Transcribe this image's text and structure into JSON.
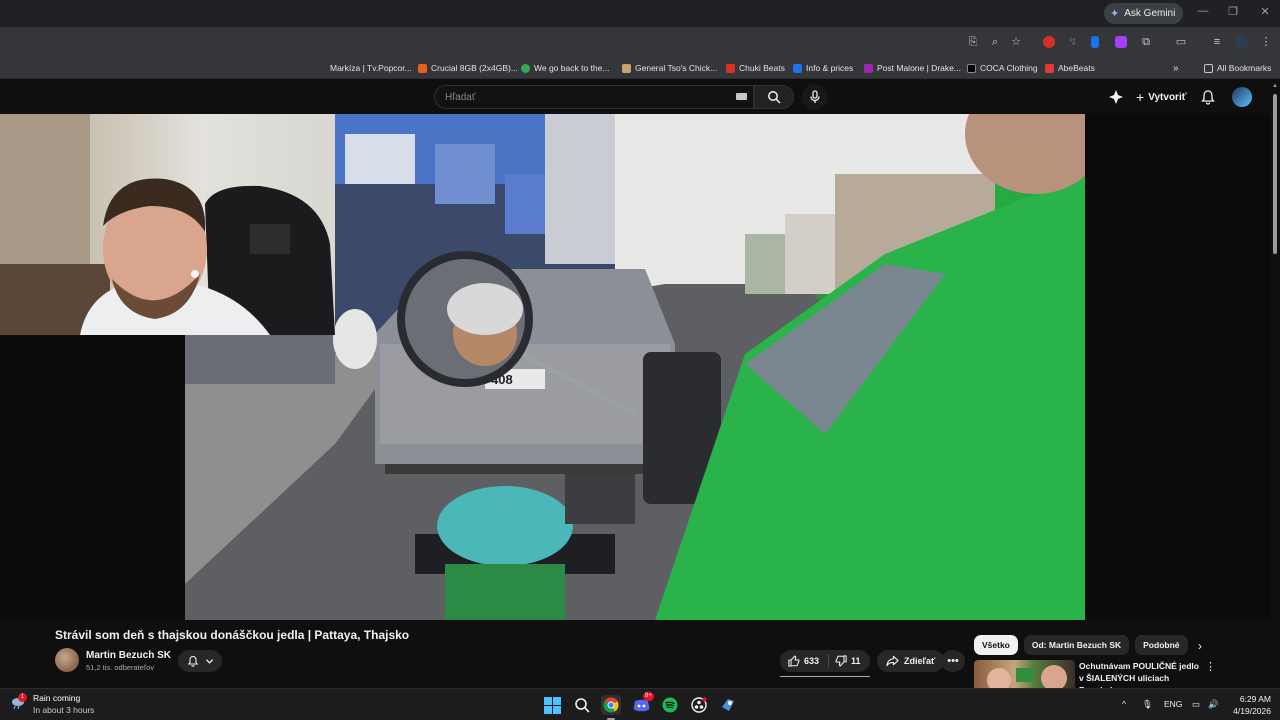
{
  "browser": {
    "ask_gemini_label": "Ask Gemini",
    "bookmarks": [
      {
        "label": "Markíza | Tv.Popcor...",
        "color": "#6b6b6b"
      },
      {
        "label": "Crucial 8GB (2x4GB)...",
        "color": "#e8601c"
      },
      {
        "label": "We go back to the...",
        "color": "#34a853"
      },
      {
        "label": "General Tso's Chick...",
        "color": "#c9a46a"
      },
      {
        "label": "Chuki Beats",
        "color": "#d93025"
      },
      {
        "label": "Info & prices",
        "color": "#1a73e8"
      },
      {
        "label": "Post Malone | Drake...",
        "color": "#9c27b0"
      },
      {
        "label": "COCA Clothing",
        "color": "#000000"
      },
      {
        "label": "AbeBeats",
        "color": "#e53935"
      }
    ],
    "all_bookmarks_label": "All Bookmarks",
    "more_bookmarks_label": "»"
  },
  "youtube": {
    "search_placeholder": "Hľadať",
    "create_label": "Vytvoriť"
  },
  "video": {
    "title": "Strávil som deň s thajskou donáščkou jedla | Pattaya, Thajsko",
    "channel_name": "Martin Bezuch SK",
    "subscribers": "51,2 tis. odberateľov",
    "likes": "633",
    "dislikes": "11",
    "share_label": "Zdieľať",
    "plate_text": "408"
  },
  "sidebar": {
    "chips": [
      {
        "label": "Všetko",
        "active": true
      },
      {
        "label": "Od: Martin Bezuch SK",
        "active": false
      },
      {
        "label": "Podobné",
        "active": false
      }
    ],
    "recommendation": {
      "title": "Ochutnávam POULIČNÉ jedlo v ŠIALENÝCH uliciach Bangkok..."
    }
  },
  "taskbar": {
    "weather_title": "Rain coming",
    "weather_subtitle": "In about 3 hours",
    "weather_badge": "1",
    "discord_badge": "9+",
    "language": "ENG",
    "time": "6:29 AM",
    "date": "4/19/2026",
    "tray_chevron": "^"
  },
  "colors": {
    "browser_frame": "#202124",
    "toolbar": "#35363a",
    "youtube_bg": "#0f0f0f",
    "chip_active": "#f1f1f1",
    "accent_red": "#e81123"
  }
}
